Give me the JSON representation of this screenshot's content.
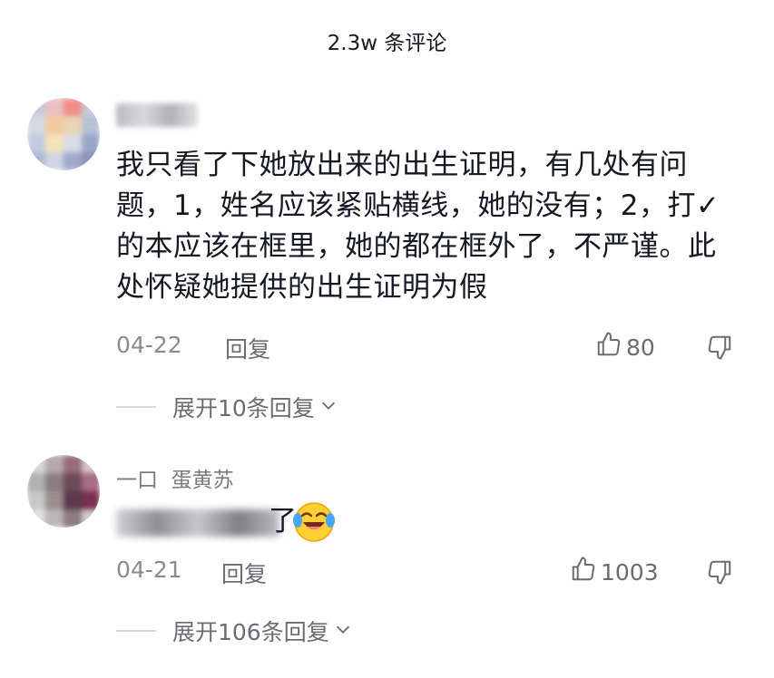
{
  "header": {
    "title": "2.3w 条评论"
  },
  "comments": [
    {
      "username": "",
      "text": "我只看了下她放出来的出生证明，有几处有问题，1，姓名应该紧贴横线，她的没有；2，打✓的本应该在框里，她的都在框外了，不严谨。此处怀疑她提供的出生证明为假",
      "date": "04-22",
      "reply_label": "回复",
      "likes": "80",
      "expand_label": "展开10条回复"
    },
    {
      "username": "一口  蛋黄苏",
      "text": "了",
      "date": "04-21",
      "reply_label": "回复",
      "likes": "1003",
      "expand_label": "展开106条回复"
    }
  ],
  "icons": {
    "like": "thumbs-up-icon",
    "dislike": "thumbs-down-icon",
    "expand": "chevron-down-icon",
    "emoji": "laughing-crying-emoji-icon"
  },
  "colors": {
    "text": "#161823",
    "secondary": "#6b6c72",
    "muted": "#8a8b91"
  }
}
